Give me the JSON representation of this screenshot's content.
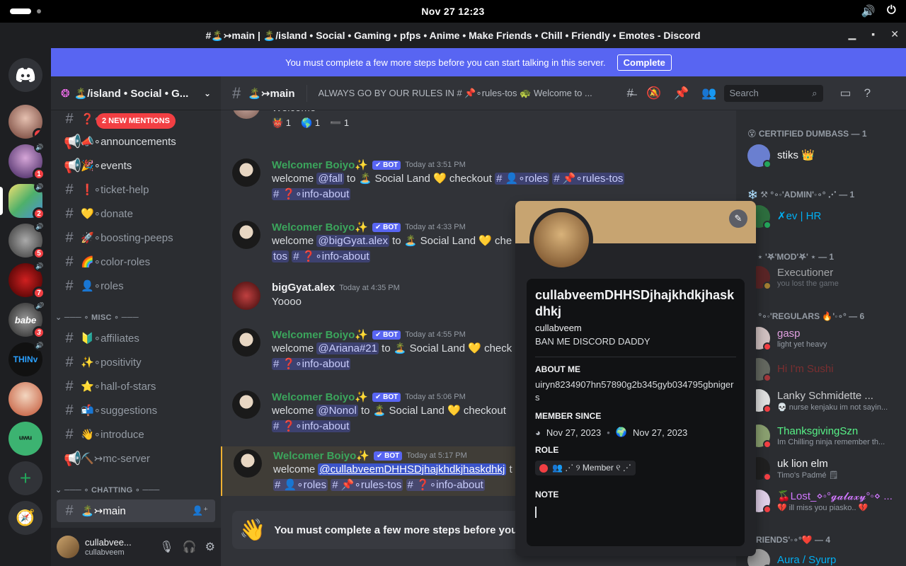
{
  "system": {
    "datetime": "Nov 27  12:23"
  },
  "window": {
    "title": "#🏝️↣main | 🏝️/island • Social • Gaming • pfps • Anime • Make Friends • Chill • Friendly • Emotes - Discord"
  },
  "banner": {
    "text": "You must complete a few more steps before you can start talking in this server.",
    "button": "Complete"
  },
  "rail": {
    "badges": [
      "4",
      "1",
      "2",
      "5",
      "7",
      "3"
    ],
    "label_thinv": "THINv",
    "label_babe": "babe"
  },
  "server": {
    "name": "🏝️/island • Social • G..."
  },
  "sidebar": {
    "new_mentions": "2 NEW MENTIONS",
    "channels": [
      {
        "icon": "#",
        "name": "❓∘info-about"
      },
      {
        "icon": "📢",
        "name": "📣∘announcements"
      },
      {
        "icon": "📢",
        "name": "🎉∘events"
      },
      {
        "icon": "#",
        "name": "❗∘ticket-help"
      },
      {
        "icon": "#",
        "name": "💛∘donate"
      },
      {
        "icon": "#",
        "name": "🚀∘boosting-peeps"
      },
      {
        "icon": "#",
        "name": "🌈∘color-roles"
      },
      {
        "icon": "#",
        "name": "👤∘roles"
      }
    ],
    "cat_misc": "⌄ ─── ∘ MISC ∘ ───",
    "misc": [
      {
        "icon": "#",
        "name": "🔰∘affiliates"
      },
      {
        "icon": "#",
        "name": "✨∘positivity"
      },
      {
        "icon": "#",
        "name": "⭐∘hall-of-stars"
      },
      {
        "icon": "#",
        "name": "📬∘suggestions"
      },
      {
        "icon": "#",
        "name": "👋∘introduce"
      },
      {
        "icon": "📢",
        "name": "⛏️↣mc-server"
      }
    ],
    "cat_chatting": "⌄ ─── ∘ CHATTING ∘ ───",
    "active_channel": "🏝️↣main"
  },
  "user": {
    "name": "cullabvee...",
    "tag": "cullabveem"
  },
  "header": {
    "channel": "🏝️↣main",
    "topic": "ALWAYS GO BY OUR RULES IN # 📌∘rules-tos 🐢 Welcome to ...",
    "search_placeholder": "Search"
  },
  "messages": {
    "top_text": "Welcome",
    "reactions": [
      "👹 1",
      "🌎 1",
      "➖ 1"
    ],
    "m1": {
      "author": "Welcomer Boiyo✨",
      "bot": "✔ BOT",
      "ts": "Today at 3:51 PM",
      "pre": "welcome ",
      "mention": "@fall",
      "mid": " to 🏝️ Social Land 💛 checkout ",
      "ch1": "# 👤∘roles",
      "ch2": "# 📌∘rules-tos",
      "ch3": "# ❓∘info-about"
    },
    "m2": {
      "author": "Welcomer Boiyo✨",
      "bot": "✔ BOT",
      "ts": "Today at 4:33 PM",
      "pre": "welcome ",
      "mention": "@bigGyat.alex",
      "mid": " to 🏝️ Social Land 💛 che",
      "ch1": "tos",
      "ch2": "# ❓∘info-about"
    },
    "m3": {
      "author": "bigGyat.alex",
      "ts": "Today at 4:35 PM",
      "text": "Yoooo"
    },
    "m4": {
      "author": "Welcomer Boiyo✨",
      "bot": "✔ BOT",
      "ts": "Today at 4:55 PM",
      "pre": "welcome ",
      "mention": "@Ariana#21",
      "mid": " to 🏝️ Social Land 💛 check",
      "ch1": "# ❓∘info-about"
    },
    "m5": {
      "author": "Welcomer Boiyo✨",
      "bot": "✔ BOT",
      "ts": "Today at 5:06 PM",
      "pre": "welcome ",
      "mention": "@Nonol",
      "mid": " to 🏝️ Social Land 💛 checkout",
      "ch1": "# ❓∘info-about"
    },
    "m6": {
      "author": "Welcomer Boiyo✨",
      "bot": "✔ BOT",
      "ts": "Today at 5:17 PM",
      "pre": "welcome ",
      "mention": "@cullabveemDHHSDjhajkhdkjhaskdhkj",
      "mid": " t",
      "ch1": "# 👤∘roles",
      "ch2": "# 📌∘rules-tos",
      "ch3": "# ❓∘info-about"
    }
  },
  "composer": {
    "emoji": "👋",
    "text": "You must complete a few more steps before you c"
  },
  "members": {
    "groups": [
      {
        "title": "😵 CERTIFIED DUMBASS — 1"
      },
      {
        "title": "❄️ ⚒ °∘◦'ADMIN'◦∘° ⋰ — 1"
      },
      {
        "title": "⚒ ⋆ '𖤐'MOD'𖤐' ⋆ — 1"
      },
      {
        "title": "⋰ °∘◦'REGULARS 🔥'◦∘° — 6"
      },
      {
        "title": "RIENDS'◦∘°❤️ — 4"
      }
    ],
    "list": [
      {
        "name": "stiks 👑",
        "status": "",
        "color": "#f2f3f5",
        "dot": "#23a55a"
      },
      {
        "name": "✗ev | HR",
        "status": "",
        "color": "#00b0f4",
        "dot": "#23a55a"
      },
      {
        "name": "Executioner",
        "status": "you lost the game",
        "color": "#9aa0a6",
        "dot": "#f0b232"
      },
      {
        "name": "gasp",
        "status": "light yet heavy",
        "color": "#e0a0e0",
        "dot": "#f23f43"
      },
      {
        "name": "Hi I'm Sushi",
        "status": "",
        "color": "#b03030",
        "dot": "#f23f43"
      },
      {
        "name": "Lanky Schmidette ...",
        "status": "💀 nurse kenjaku im not sayin...",
        "color": "#f2f3f5",
        "dot": "#f23f43"
      },
      {
        "name": "ThanksgivingSzn",
        "status": "Im Chilling ninja remember th...",
        "color": "#57f287",
        "dot": "#f23f43"
      },
      {
        "name": "uk lion elm",
        "status": "Timo's Padmé 🗒",
        "color": "#f2f3f5",
        "dot": "#f23f43"
      },
      {
        "name": "🍒Lost_⋄◦°𝓰𝓪𝓵𝓪𝔁𝔂°◦⋄ ...",
        "status": "💔 ill miss you piasko.. 💔",
        "color": "#d177ff",
        "dot": "#f23f43"
      },
      {
        "name": "Aura / Syurp",
        "status": "",
        "color": "#00b0f4",
        "dot": "#23a55a"
      }
    ]
  },
  "profile": {
    "display_name": "cullabveemDHHSDjhajkhdkjhaskdhkj",
    "username": "cullabveem",
    "pronouns": "BAN ME DISCORD DADDY",
    "about_label": "ABOUT ME",
    "about": "uiryn8234907hn57890g2b345gyb034795gbnigers",
    "since_label": "MEMBER SINCE",
    "since_discord": "Nov 27, 2023",
    "since_server": "Nov 27, 2023",
    "role_label": "ROLE",
    "role": "👥 ⋰ ୨ Member ୧ ⋰",
    "note_label": "NOTE"
  }
}
